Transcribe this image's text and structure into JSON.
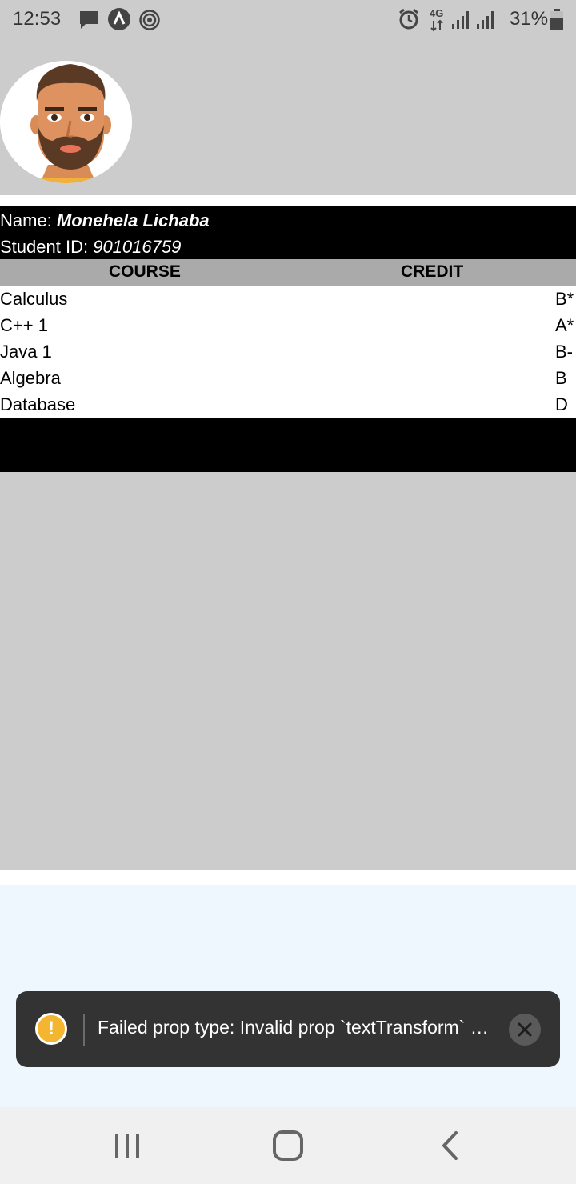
{
  "status_bar": {
    "time": "12:53",
    "battery_percent": "31%",
    "network_label": "4G",
    "icons": [
      "message-icon",
      "app-icon",
      "hotspot-icon",
      "alarm-icon",
      "network-4g-icon",
      "signal-icon",
      "signal-icon",
      "battery-icon"
    ]
  },
  "student": {
    "name_label": "Name:",
    "name": "Monehela Lichaba",
    "id_label": "Student ID:",
    "id": "901016759"
  },
  "table": {
    "headers": [
      "COURSE",
      "CREDIT"
    ],
    "rows": [
      {
        "course": "Calculus",
        "credit": "B*"
      },
      {
        "course": "C++ 1",
        "credit": "A*"
      },
      {
        "course": "Java 1",
        "credit": "B-"
      },
      {
        "course": "Algebra",
        "credit": "B"
      },
      {
        "course": "Database",
        "credit": "D"
      }
    ]
  },
  "toast": {
    "message": "Failed prop type: Invalid prop `textTransform` …",
    "icon": "warning-icon"
  },
  "nav_bar": {
    "buttons": [
      "recent-apps-icon",
      "home-icon",
      "back-icon"
    ]
  },
  "colors": {
    "status_bg": "#cccccc",
    "info_bg": "#000000",
    "table_head_bg": "#aaaaaa",
    "toast_bg": "#333333",
    "warning": "#f4b531"
  }
}
